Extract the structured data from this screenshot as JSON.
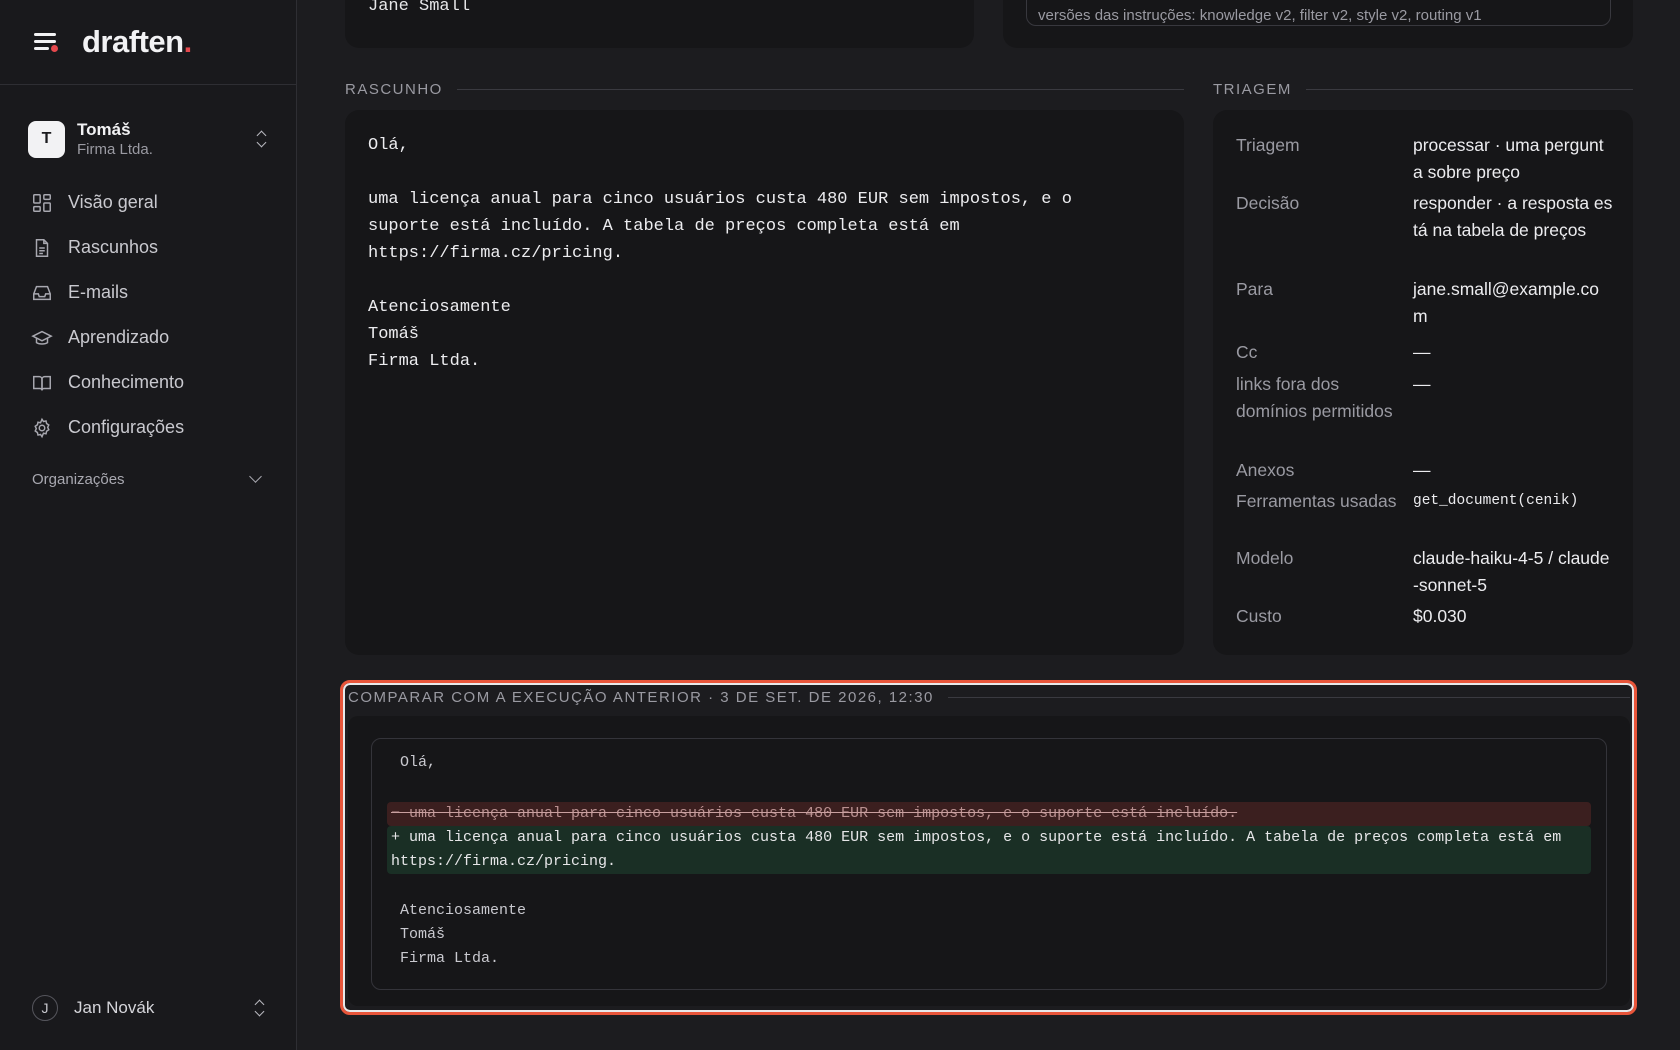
{
  "brand": {
    "name": "draften",
    "dot": "."
  },
  "account": {
    "initial": "T",
    "name": "Tomáš",
    "org": "Firma Ltda."
  },
  "nav": [
    {
      "label": "Visão geral",
      "icon": "dashboard-icon"
    },
    {
      "label": "Rascunhos",
      "icon": "document-icon"
    },
    {
      "label": "E-mails",
      "icon": "inbox-icon"
    },
    {
      "label": "Aprendizado",
      "icon": "graduation-cap-icon"
    },
    {
      "label": "Conhecimento",
      "icon": "book-icon"
    },
    {
      "label": "Configurações",
      "icon": "gear-icon"
    }
  ],
  "organizations": {
    "label": "Organizações"
  },
  "user": {
    "initial": "J",
    "name": "Jan Novák"
  },
  "top": {
    "recipient_name": "Jane Small",
    "instructions_versions": "versões das instruções: knowledge v2, filter v2, style v2, routing v1"
  },
  "draft_section": {
    "title": "RASCUNHO",
    "body": "Olá,\n\numa licença anual para cinco usuários custa 480 EUR sem impostos, e o\nsuporte está incluído. A tabela de preços completa está em\nhttps://firma.cz/pricing.\n\nAtenciosamente\nTomáš\nFirma Ltda."
  },
  "triage_section": {
    "title": "TRIAGEM",
    "rows": [
      {
        "key": "Triagem",
        "value": "processar · uma pergunta sobre preço"
      },
      {
        "key": "Decisão",
        "value": "responder · a resposta está na tabela de preços"
      },
      {
        "key": "Para",
        "value": "jane.small@example.com"
      },
      {
        "key": "Cc",
        "value": "—"
      },
      {
        "key": "links fora dos domínios permitidos",
        "value": "—"
      },
      {
        "key": "Anexos",
        "value": "—"
      },
      {
        "key": "Ferramentas usadas",
        "value": "get_document(cenik)"
      },
      {
        "key": "Modelo",
        "value": "claude-haiku-4-5 / claude-sonnet-5"
      },
      {
        "key": "Custo",
        "value": "$0.030"
      }
    ]
  },
  "compare_section": {
    "title": "COMPARAR COM A EXECUÇÃO ANTERIOR · 3 DE SET. DE 2026, 12:30",
    "greeting": "Olá,",
    "removed": "− uma licença anual para cinco usuários custa 480 EUR sem impostos, e o suporte está incluído.",
    "added": "+ uma licença anual para cinco usuários custa 480 EUR sem impostos, e o suporte está incluído. A tabela de preços completa está em\nhttps://firma.cz/pricing.",
    "closing": "Atenciosamente",
    "sig_name": "Tomáš",
    "sig_org": "Firma Ltda."
  },
  "colors": {
    "accent": "#e5484d",
    "highlight_border": "#e8553a",
    "diff_removed_bg": "#3b1f1f",
    "diff_added_bg": "#1a2f25"
  }
}
